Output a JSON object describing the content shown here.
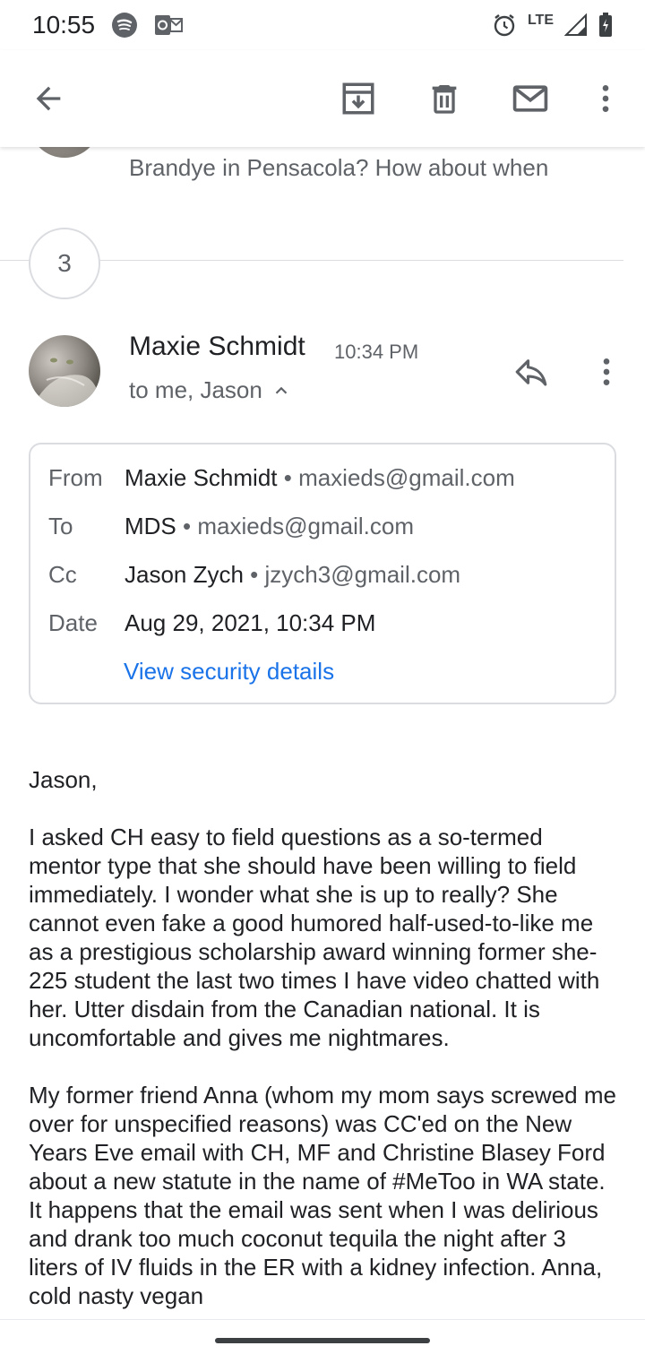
{
  "status": {
    "time": "10:55",
    "network": "LTE"
  },
  "thread": {
    "hidden_count": "3",
    "previous_snippet": "Brandye in Pensacola? How about when"
  },
  "message": {
    "sender": "Maxie Schmidt",
    "time": "10:34 PM",
    "recipients": "to me, Jason",
    "details": {
      "from_label": "From",
      "from_name": "Maxie Schmidt",
      "from_email": "maxieds@gmail.com",
      "to_label": "To",
      "to_name": "MDS",
      "to_email": "maxieds@gmail.com",
      "cc_label": "Cc",
      "cc_name": "Jason Zych",
      "cc_email": "jzych3@gmail.com",
      "date_label": "Date",
      "date_value": "Aug 29, 2021, 10:34 PM",
      "security_link": "View security details"
    },
    "body": [
      "Jason,",
      "I asked CH easy to field questions as a so-termed mentor type that she should have been willing to field immediately. I wonder what she is up to really? She cannot even fake a good humored half-used-to-like me as a prestigious scholarship award winning former she-225 student the last two times I have video chatted with her. Utter disdain from the Canadian national. It is uncomfortable and gives me nightmares.",
      "My former friend Anna (whom my mom says screwed me over for unspecified reasons) was CC'ed on the New Years Eve email with CH, MF and Christine Blasey Ford about a new statute in the name of #MeToo in WA state. It happens that the email was sent when I was delirious and drank too much coconut tequila the night after 3 liters of IV fluids in the ER with a kidney infection. Anna, cold nasty vegan"
    ]
  },
  "icons": {
    "back": "arrow-left-icon",
    "archive": "archive-icon",
    "delete": "trash-icon",
    "unread": "mail-icon",
    "more": "more-vert-icon",
    "reply": "reply-icon"
  },
  "colors": {
    "link": "#1a73e8",
    "secondary_text": "#5f6368",
    "primary_text": "#202124"
  }
}
